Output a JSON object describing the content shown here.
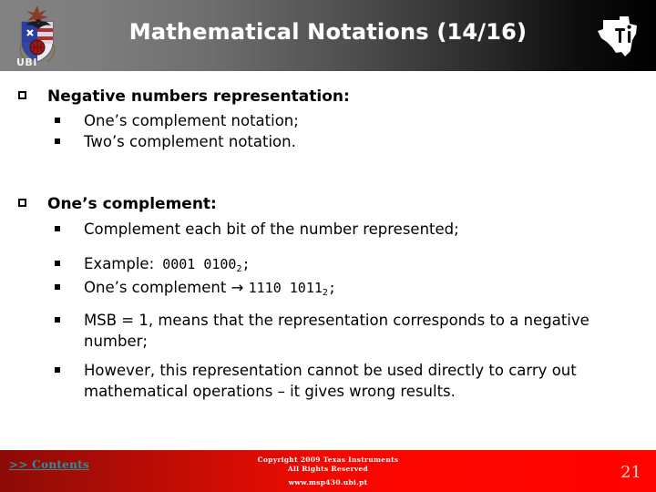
{
  "header": {
    "title": "Mathematical Notations (14/16)",
    "left_logo_label": "UBI",
    "left_logo_name": "ubi-crest-logo",
    "right_logo_name": "ti-texas-instruments-logo",
    "gradient_from": "#828282",
    "gradient_to": "#000000",
    "title_color": "#ffffff"
  },
  "body": {
    "sections": [
      {
        "heading": "Negative numbers representation:",
        "items": [
          "One’s complement notation;",
          "Two’s complement notation."
        ]
      },
      {
        "heading": "One’s complement:",
        "items": [
          "Complement each bit of the number represented;",
          "MSB = 1, means that the representation corresponds to a negative number;",
          "However, this representation cannot be used directly to carry out mathematical operations – it gives wrong results."
        ]
      }
    ],
    "example_line": {
      "label": "Example:",
      "value": "0001 0100",
      "subscript": "2",
      "terminator": ";"
    },
    "complement_line": {
      "label": "One’s complement",
      "arrow": "→",
      "value": "1110 1011",
      "subscript": "2",
      "terminator": ";"
    },
    "bullet_level1_glyph": "❑",
    "bullet_level2_glyph": "▪"
  },
  "footer": {
    "contents_link": ">> Contents",
    "copyright_line1": "Copyright 2009 Texas Instruments",
    "copyright_line2": "All Rights Reserved",
    "url": "www.msp430.ubi.pt",
    "page_number": "21",
    "gradient_from": "#8c0b07",
    "gradient_to": "#ff0400",
    "link_color": "#2f8f96",
    "page_number_color": "#ffd9d4"
  }
}
